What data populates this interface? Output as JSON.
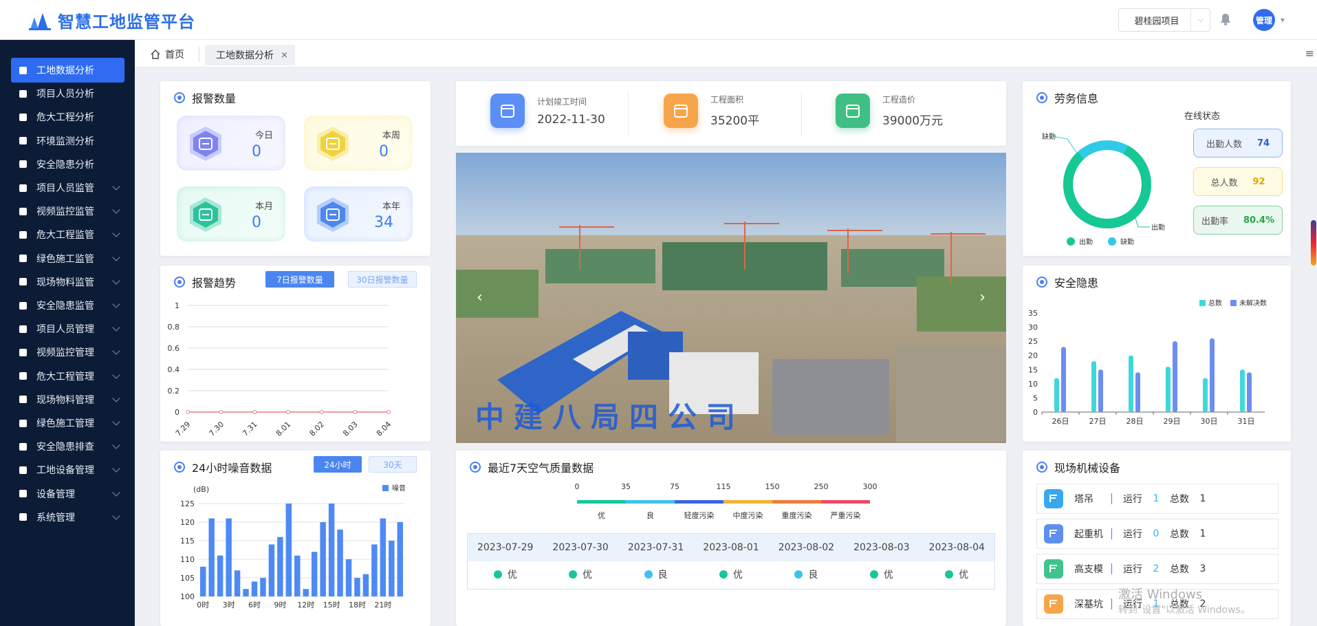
{
  "header": {
    "logo_text": "智慧工地监管平台",
    "project": "碧桂园项目",
    "avatar": "管理"
  },
  "sidebar": {
    "items": [
      {
        "label": "工地数据分析",
        "active": true,
        "arrow": false,
        "icon": "chart-icon"
      },
      {
        "label": "项目人员分析",
        "arrow": false,
        "icon": "user-icon"
      },
      {
        "label": "危大工程分析",
        "arrow": false,
        "icon": "filter-icon"
      },
      {
        "label": "环境监测分析",
        "arrow": false,
        "icon": "leaf-icon"
      },
      {
        "label": "安全隐患分析",
        "arrow": false,
        "icon": "document-icon"
      },
      {
        "label": "项目人员监管",
        "arrow": true,
        "icon": "users-icon"
      },
      {
        "label": "视频监控监管",
        "arrow": true,
        "icon": "camera-icon"
      },
      {
        "label": "危大工程监管",
        "arrow": true,
        "icon": "layers-icon"
      },
      {
        "label": "绿色施工监管",
        "arrow": true,
        "icon": "cube-icon"
      },
      {
        "label": "现场物料监管",
        "arrow": true,
        "icon": "truck-icon"
      },
      {
        "label": "安全隐患监管",
        "arrow": true,
        "icon": "warning-icon"
      },
      {
        "label": "项目人员管理",
        "arrow": true,
        "icon": "users-icon"
      },
      {
        "label": "视频监控管理",
        "arrow": true,
        "icon": "cube-icon"
      },
      {
        "label": "危大工程管理",
        "arrow": true,
        "icon": "document-icon"
      },
      {
        "label": "现场物料管理",
        "arrow": true,
        "icon": "cube-icon"
      },
      {
        "label": "绿色施工管理",
        "arrow": true,
        "icon": "user-icon"
      },
      {
        "label": "安全隐患排查",
        "arrow": true,
        "icon": "document-icon"
      },
      {
        "label": "工地设备管理",
        "arrow": true,
        "icon": "user-icon"
      },
      {
        "label": "设备管理",
        "arrow": true,
        "icon": "user-icon"
      },
      {
        "label": "系统管理",
        "arrow": true,
        "icon": "user-icon"
      }
    ]
  },
  "tabs": {
    "home": "首页",
    "active": "工地数据分析",
    "close": "×"
  },
  "alarm": {
    "title": "报警数量",
    "cards": [
      {
        "label": "今日",
        "value": "0",
        "color": "#7f83f0"
      },
      {
        "label": "本周",
        "value": "0",
        "color": "#f0d33c"
      },
      {
        "label": "本月",
        "value": "0",
        "color": "#2bc49a"
      },
      {
        "label": "本年",
        "value": "34",
        "color": "#4d87ef"
      }
    ]
  },
  "trend": {
    "title": "报警趋势",
    "btn_7": "7日报警数量",
    "btn_30": "30日报警数量"
  },
  "noise": {
    "title": "24小时噪音数据",
    "btn_24": "24小时",
    "btn_30": "30天",
    "unit": "(dB)",
    "legend": "噪音"
  },
  "project_info": [
    {
      "label": "计划竣工时间",
      "value": "2022-11-30",
      "color": "#5b8ff5"
    },
    {
      "label": "工程面积",
      "value": "35200平",
      "color": "#f7a54a"
    },
    {
      "label": "工程造价",
      "value": "39000万元",
      "color": "#3fbf84"
    }
  ],
  "photo": {
    "banner": "中建八局四公司",
    "prev": "‹",
    "next": "›"
  },
  "labor": {
    "title": "劳务信息",
    "online": "在线状态",
    "absent_label": "缺勤",
    "present_label": "出勤",
    "attendance_fraction": 0.804,
    "stats": [
      {
        "label": "出勤人数",
        "value": "74"
      },
      {
        "label": "总人数",
        "value": "92"
      },
      {
        "label": "出勤率",
        "value": "80.4%"
      }
    ]
  },
  "safety": {
    "title": "安全隐患",
    "legend": [
      "总数",
      "未解决数"
    ]
  },
  "air": {
    "title": "最近7天空气质量数据",
    "scale_numbers": [
      "0",
      "35",
      "75",
      "115",
      "150",
      "250",
      "300"
    ],
    "scale_labels": [
      "优",
      "良",
      "轻度污染",
      "中度污染",
      "重度污染",
      "严重污染"
    ],
    "scale_colors": [
      "#16c79a",
      "#3ec2ef",
      "#3a64e0",
      "#f0b434",
      "#ef7d3c",
      "#ee4a68"
    ],
    "dates": [
      "2023-07-29",
      "2023-07-30",
      "2023-07-31",
      "2023-08-01",
      "2023-08-02",
      "2023-08-03",
      "2023-08-04"
    ],
    "levels": [
      {
        "label": "优",
        "color": "#16c79a"
      },
      {
        "label": "优",
        "color": "#16c79a"
      },
      {
        "label": "良",
        "color": "#3ec2ef"
      },
      {
        "label": "优",
        "color": "#16c79a"
      },
      {
        "label": "良",
        "color": "#3ec2ef"
      },
      {
        "label": "优",
        "color": "#16c79a"
      },
      {
        "label": "优",
        "color": "#16c79a"
      }
    ]
  },
  "machines": {
    "title": "现场机械设备",
    "run_label": "运行",
    "total_label": "总数",
    "rows": [
      {
        "name": "塔吊",
        "run": "1",
        "total": "1",
        "color": "#3aa8f0"
      },
      {
        "name": "起重机",
        "run": "0",
        "total": "1",
        "color": "#5e8ff0"
      },
      {
        "name": "高支模",
        "run": "2",
        "total": "3",
        "color": "#3ec48c"
      },
      {
        "name": "深基坑",
        "run": "1",
        "total": "2",
        "color": "#f7a54a"
      }
    ]
  },
  "watermark": {
    "line1": "激活 Windows",
    "line2": "转到\"设置\"以激活 Windows。"
  },
  "chart_data": [
    {
      "type": "line",
      "title": "报警趋势",
      "categories": [
        "7.29",
        "7.30",
        "7.31",
        "8.01",
        "8.02",
        "8.03",
        "8.04"
      ],
      "series": [
        {
          "values": [
            0,
            0,
            0,
            0,
            0,
            0,
            0
          ]
        }
      ],
      "ylim": [
        0,
        1
      ],
      "yticks": [
        "0",
        "0.2",
        "0.4",
        "0.6",
        "0.8",
        "1"
      ],
      "grid": true
    },
    {
      "type": "bar",
      "title": "24小时噪音数据",
      "ylabel": "(dB)",
      "ylim": [
        100,
        125
      ],
      "yticks": [
        "100",
        "105",
        "110",
        "115",
        "120",
        "125"
      ],
      "x_tick_labels": [
        "0时",
        "3时",
        "6时",
        "9时",
        "12时",
        "15时",
        "18时",
        "21时"
      ],
      "series": [
        {
          "name": "噪音",
          "values": [
            108,
            121,
            111,
            121,
            107,
            102,
            104,
            105,
            114,
            116,
            125,
            111,
            102,
            112,
            120,
            125,
            118,
            110,
            105,
            106,
            114,
            121,
            115,
            120
          ]
        }
      ]
    },
    {
      "type": "bar",
      "title": "安全隐患",
      "categories": [
        "26日",
        "27日",
        "28日",
        "29日",
        "30日",
        "31日"
      ],
      "ylim": [
        0,
        35
      ],
      "yticks": [
        "0",
        "5",
        "10",
        "15",
        "20",
        "25",
        "30",
        "35"
      ],
      "legend": "top-right",
      "series": [
        {
          "name": "总数",
          "values": [
            12,
            18,
            20,
            16,
            12,
            15
          ]
        },
        {
          "name": "未解决数",
          "values": [
            23,
            15,
            14,
            25,
            26,
            14
          ]
        }
      ]
    },
    {
      "type": "pie",
      "title": "劳务信息",
      "categories": [
        "出勤",
        "缺勤"
      ],
      "values": [
        74,
        18
      ]
    }
  ]
}
